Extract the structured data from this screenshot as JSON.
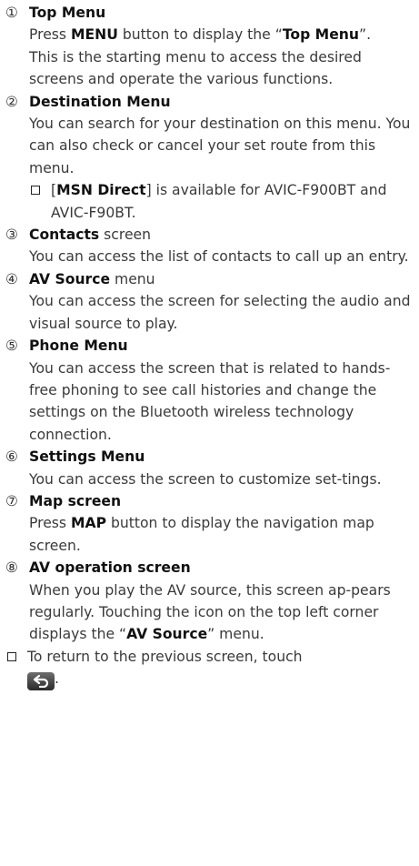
{
  "items": [
    {
      "num": "①",
      "title": "Top Menu",
      "title_suffix": "",
      "para1": {
        "pre": "Press ",
        "b1": "MENU",
        "mid": " button to display the “",
        "b2": "Top Menu",
        "post": "”."
      },
      "para2": "This is the starting menu to access the desired screens and operate the various functions."
    },
    {
      "num": "②",
      "title": "Destination Menu",
      "title_suffix": "",
      "para1": "You can search for your destination on this menu. You can also check or cancel your set route from this menu.",
      "note": {
        "open": "[",
        "b": "MSN Direct",
        "rest": "] is available for AVIC-F900BT and AVIC-F90BT."
      }
    },
    {
      "num": "③",
      "title": "Contacts",
      "title_suffix": " screen",
      "para1": "You can access the list of contacts to call up an entry."
    },
    {
      "num": "④",
      "title": "AV Source",
      "title_suffix": " menu",
      "para1": "You can access the screen for selecting the audio and visual source to play."
    },
    {
      "num": "⑤",
      "title": "Phone Menu",
      "title_suffix": "",
      "para1": "You can access the screen that is related to hands-free phoning to see call histories and change the settings on the Bluetooth wireless technology connection."
    },
    {
      "num": "⑥",
      "title": "Settings Menu",
      "title_suffix": "",
      "para1": "You can access the screen to customize set-tings."
    },
    {
      "num": "⑦",
      "title": "Map screen",
      "title_suffix": "",
      "para1": {
        "pre": "Press ",
        "b1": "MAP",
        "post": " button to display the navigation map screen."
      }
    },
    {
      "num": "⑧",
      "title": "AV operation screen",
      "title_suffix": "",
      "para1": {
        "pre": "When you play the AV source, this screen ap-pears regularly. Touching the icon on the top left corner displays the “",
        "b1": "AV Source",
        "post": "” menu."
      }
    }
  ],
  "final_note": {
    "text": "To return to the previous screen, touch",
    "post": "."
  },
  "icons": {
    "note_box": "checkbox-square-icon",
    "back": "back-arrow-icon"
  }
}
